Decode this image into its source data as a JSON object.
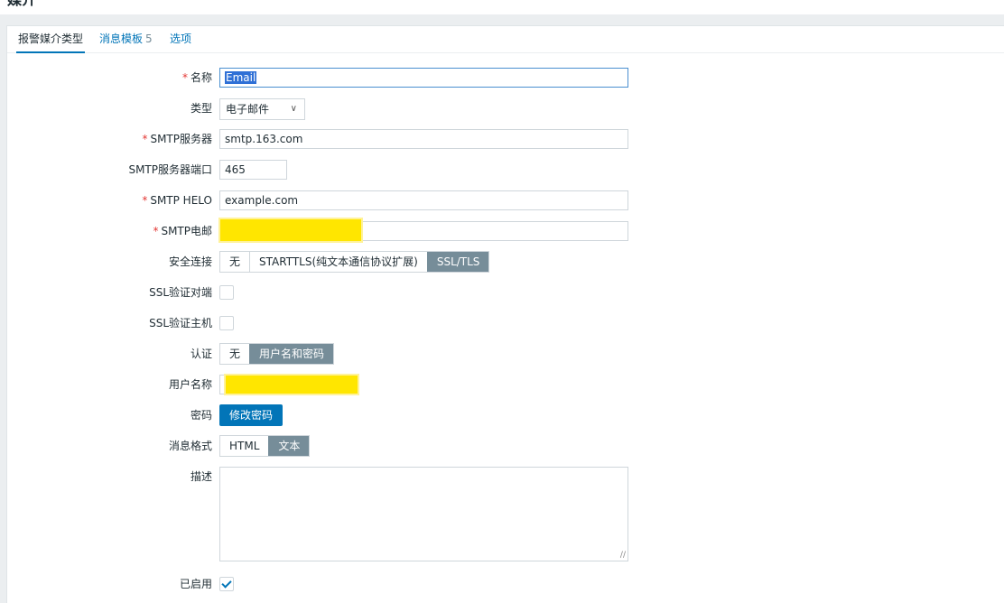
{
  "page": {
    "title": "媒介"
  },
  "tabs": [
    {
      "label": "报警媒介类型",
      "count": ""
    },
    {
      "label": "消息模板",
      "count": "5"
    },
    {
      "label": "选项",
      "count": ""
    }
  ],
  "form": {
    "name": {
      "label": "名称",
      "value": "Email",
      "required": "*"
    },
    "type": {
      "label": "类型",
      "value": "电子邮件"
    },
    "smtp_server": {
      "label": "SMTP服务器",
      "value": "smtp.163.com",
      "required": "*"
    },
    "smtp_port": {
      "label": "SMTP服务器端口",
      "value": "465"
    },
    "smtp_helo": {
      "label": "SMTP HELO",
      "value": "example.com",
      "required": "*"
    },
    "smtp_email": {
      "label": "SMTP电邮",
      "value": "",
      "required": "*"
    },
    "security": {
      "label": "安全连接",
      "options": [
        "无",
        "STARTTLS(纯文本通信协议扩展)",
        "SSL/TLS"
      ],
      "selected": "SSL/TLS"
    },
    "ssl_verify_peer": {
      "label": "SSL验证对端"
    },
    "ssl_verify_host": {
      "label": "SSL验证主机"
    },
    "auth": {
      "label": "认证",
      "options": [
        "无",
        "用户名和密码"
      ],
      "selected": "用户名和密码"
    },
    "username": {
      "label": "用户名称",
      "value": ""
    },
    "password": {
      "label": "密码",
      "button": "修改密码"
    },
    "message_format": {
      "label": "消息格式",
      "options": [
        "HTML",
        "文本"
      ],
      "selected": "文本"
    },
    "description": {
      "label": "描述",
      "value": ""
    },
    "enabled": {
      "label": "已启用",
      "checked": true
    }
  },
  "colors": {
    "accent": "#0275b8",
    "segment_active": "#768d99",
    "required": "#e33734",
    "redaction": "#ffe600"
  }
}
